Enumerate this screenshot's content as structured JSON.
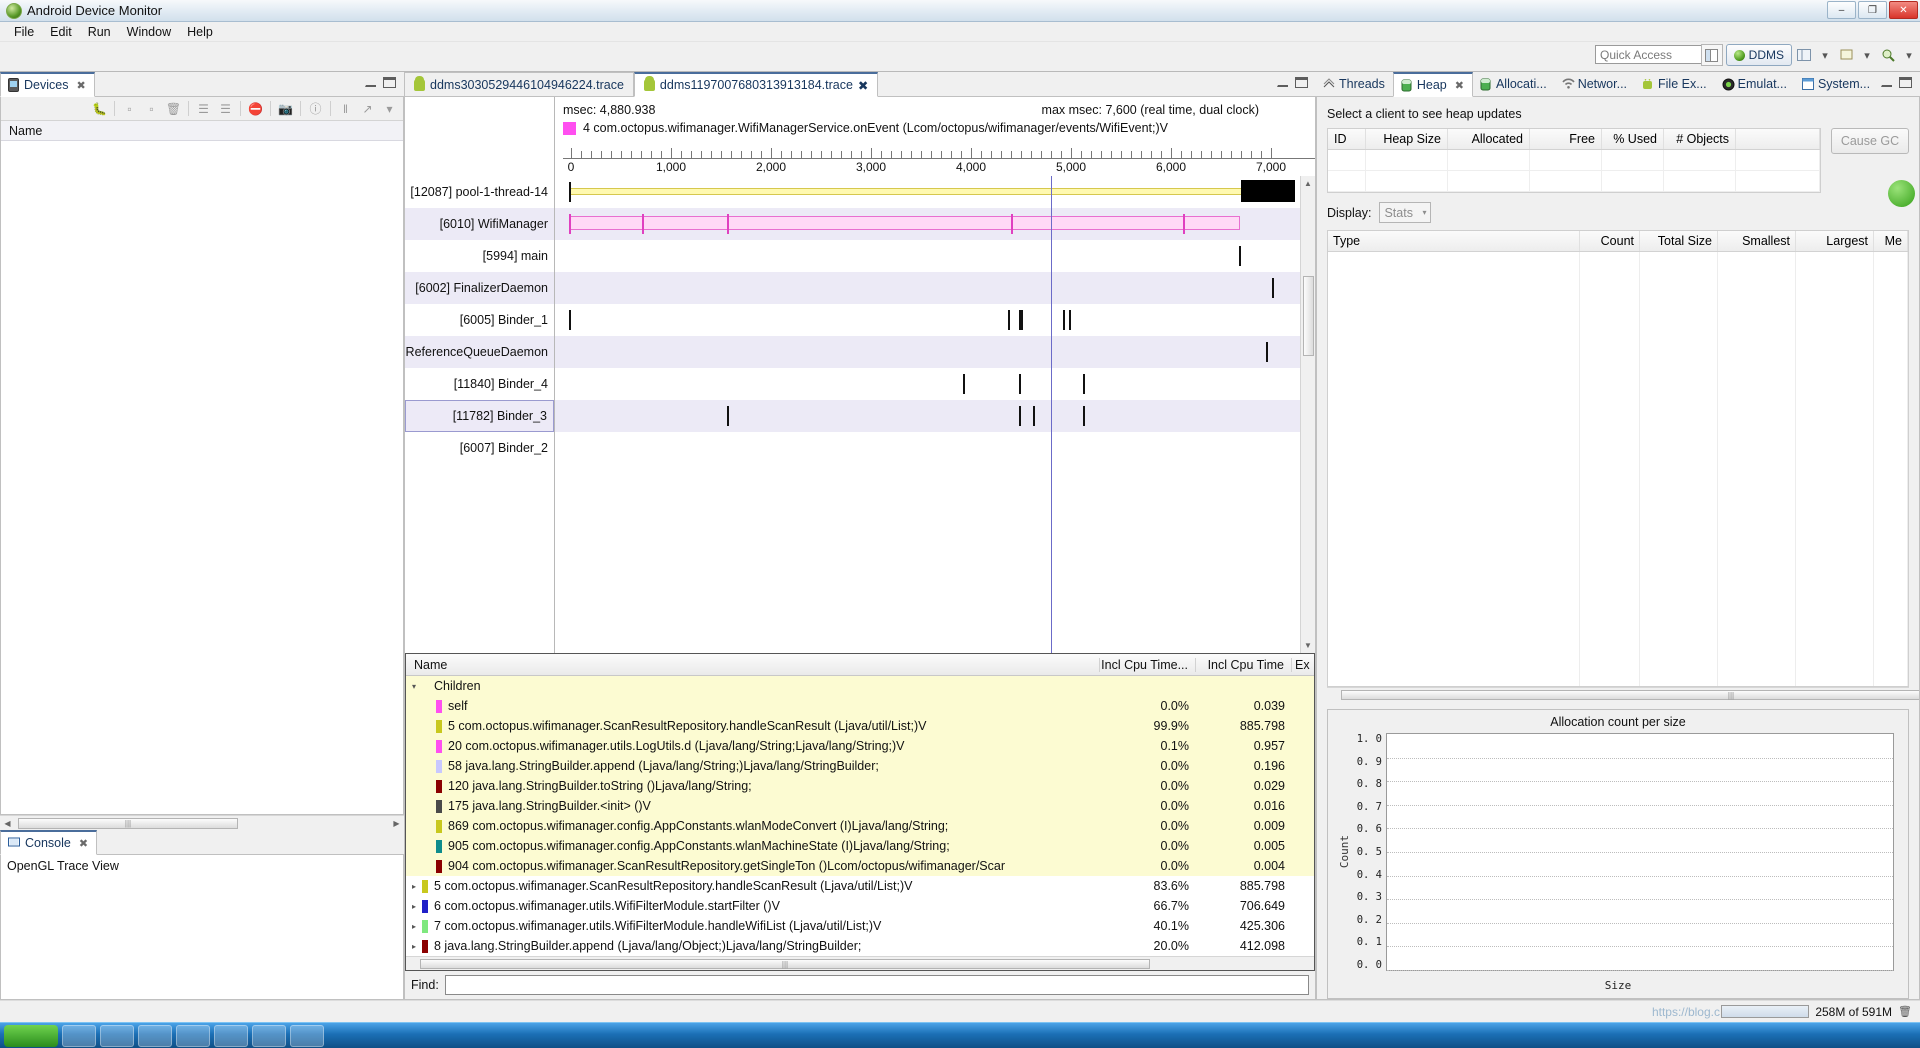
{
  "window": {
    "title": "Android Device Monitor",
    "icon": "android-logo-icon",
    "minimize": "–",
    "maximize": "❐",
    "close": "✕"
  },
  "menu": {
    "items": [
      "File",
      "Edit",
      "Run",
      "Window",
      "Help"
    ]
  },
  "toolbar": {
    "quick_access_placeholder": "Quick Access",
    "open_perspective_icon": "open-perspective-icon",
    "perspective_label": "DDMS",
    "icons": [
      "layout-icon",
      "chevron-down-icon",
      "pin-icon",
      "chevron-down-icon",
      "search-icon",
      "chevron-down-icon"
    ]
  },
  "devices_view": {
    "tab_label": "Devices",
    "tab_icon": "device-icon",
    "close_icon": "close-icon",
    "toolbar_icons": [
      "debug-icon",
      "heap-icon",
      "heap-dump-icon",
      "trash-icon",
      "threads-icon",
      "method-profiling-icon",
      "stop-icon",
      "screenshot-icon",
      "info-icon",
      "systrace-icon",
      "trace-icon",
      "view-menu-icon"
    ],
    "column_header": "Name",
    "rows": []
  },
  "editor": {
    "tabs": [
      {
        "label": "ddms3030529446104946224.trace",
        "icon": "android-icon",
        "active": false
      },
      {
        "label": "ddms1197007680313913184.trace",
        "icon": "android-icon",
        "active": true,
        "close_icon": "close-icon"
      }
    ],
    "minimize_icon": "minimize-icon",
    "maximize_icon": "maximize-icon"
  },
  "timeline": {
    "msec_label": "msec: 4,880.938",
    "max_msec_label": "max msec: 7,600 (real time, dual clock)",
    "selected_method": "4 com.octopus.wifimanager.WifiManagerService.onEvent (Lcom/octopus/wifimanager/events/WifiEvent;)V",
    "selected_method_color": "#ff4ff0",
    "axis_ticks": [
      "0",
      "1,000",
      "2,000",
      "3,000",
      "4,000",
      "5,000",
      "6,000",
      "7,000"
    ],
    "threads": [
      {
        "label": "[12087] pool-1-thread-14"
      },
      {
        "label": "[6010] WifiManager"
      },
      {
        "label": "[5994] main"
      },
      {
        "label": "[6002] FinalizerDaemon"
      },
      {
        "label": "[6005] Binder_1"
      },
      {
        "label": "ReferenceQueueDaemon"
      },
      {
        "label": "[11840] Binder_4"
      },
      {
        "label": "[11782] Binder_3"
      },
      {
        "label": "[6007] Binder_2"
      }
    ]
  },
  "profile_table": {
    "columns": [
      "Name",
      "Incl Cpu Time...",
      "Incl Cpu Time",
      "Ex"
    ],
    "rows": [
      {
        "indent": 0,
        "arrow": "▾",
        "chip": "",
        "name": "Children",
        "c1": "",
        "c2": "",
        "highlight": true
      },
      {
        "indent": 1,
        "arrow": "",
        "chip": "#ff4ff0",
        "name": "self",
        "c1": "0.0%",
        "c2": "0.039",
        "highlight": true
      },
      {
        "indent": 1,
        "arrow": "",
        "chip": "#c8c81e",
        "name": "5 com.octopus.wifimanager.ScanResultRepository.handleScanResult (Ljava/util/List;)V",
        "c1": "99.9%",
        "c2": "885.798",
        "highlight": true
      },
      {
        "indent": 1,
        "arrow": "",
        "chip": "#ff4ff0",
        "name": "20 com.octopus.wifimanager.utils.LogUtils.d (Ljava/lang/String;Ljava/lang/String;)V",
        "c1": "0.1%",
        "c2": "0.957",
        "highlight": true
      },
      {
        "indent": 1,
        "arrow": "",
        "chip": "#c8c8ff",
        "name": "58 java.lang.StringBuilder.append (Ljava/lang/String;)Ljava/lang/StringBuilder;",
        "c1": "0.0%",
        "c2": "0.196",
        "highlight": true
      },
      {
        "indent": 1,
        "arrow": "",
        "chip": "#8b0000",
        "name": "120 java.lang.StringBuilder.toString ()Ljava/lang/String;",
        "c1": "0.0%",
        "c2": "0.029",
        "highlight": true
      },
      {
        "indent": 1,
        "arrow": "",
        "chip": "#4a4a4a",
        "name": "175 java.lang.StringBuilder.<init> ()V",
        "c1": "0.0%",
        "c2": "0.016",
        "highlight": true
      },
      {
        "indent": 1,
        "arrow": "",
        "chip": "#c8c81e",
        "name": "869 com.octopus.wifimanager.config.AppConstants.wlanModeConvert (I)Ljava/lang/String;",
        "c1": "0.0%",
        "c2": "0.009",
        "highlight": true
      },
      {
        "indent": 1,
        "arrow": "",
        "chip": "#0e8c8c",
        "name": "905 com.octopus.wifimanager.config.AppConstants.wlanMachineState (I)Ljava/lang/String;",
        "c1": "0.0%",
        "c2": "0.005",
        "highlight": true
      },
      {
        "indent": 1,
        "arrow": "",
        "chip": "#8b0000",
        "name": "904 com.octopus.wifimanager.ScanResultRepository.getSingleTon ()Lcom/octopus/wifimanager/Scar",
        "c1": "0.0%",
        "c2": "0.004",
        "highlight": true
      },
      {
        "indent": 0,
        "arrow": "▸",
        "chip": "#c8c81e",
        "name": "5 com.octopus.wifimanager.ScanResultRepository.handleScanResult (Ljava/util/List;)V",
        "c1": "83.6%",
        "c2": "885.798",
        "highlight": false
      },
      {
        "indent": 0,
        "arrow": "▸",
        "chip": "#2020c8",
        "name": "6 com.octopus.wifimanager.utils.WifiFilterModule.startFilter ()V",
        "c1": "66.7%",
        "c2": "706.649",
        "highlight": false
      },
      {
        "indent": 0,
        "arrow": "▸",
        "chip": "#7ee87e",
        "name": "7 com.octopus.wifimanager.utils.WifiFilterModule.handleWifiList (Ljava/util/List;)V",
        "c1": "40.1%",
        "c2": "425.306",
        "highlight": false
      },
      {
        "indent": 0,
        "arrow": "▸",
        "chip": "#8b0000",
        "name": "8 java.lang.StringBuilder.append (Ljava/lang/Object;)Ljava/lang/StringBuilder;",
        "c1": "20.0%",
        "c2": "412.098",
        "highlight": false
      }
    ],
    "find_label": "Find:",
    "find_value": ""
  },
  "right_tabs": [
    {
      "label": "Threads",
      "icon": "threads-icon",
      "active": false
    },
    {
      "label": "Heap",
      "icon": "heap-icon",
      "active": true,
      "close_icon": "close-icon"
    },
    {
      "label": "Allocati...",
      "icon": "allocation-tracker-icon",
      "active": false
    },
    {
      "label": "Networ...",
      "icon": "network-icon",
      "active": false
    },
    {
      "label": "File Ex...",
      "icon": "file-explorer-icon",
      "active": false
    },
    {
      "label": "Emulat...",
      "icon": "emulator-control-icon",
      "active": false
    },
    {
      "label": "System...",
      "icon": "system-information-icon",
      "active": false
    }
  ],
  "heap_panel": {
    "message": "Select a client to see heap updates",
    "columns": [
      "ID",
      "Heap Size",
      "Allocated",
      "Free",
      "% Used",
      "# Objects"
    ],
    "rows": [],
    "cause_gc_button": "Cause GC",
    "display_label": "Display:",
    "display_value": "Stats",
    "stats_columns": [
      "Type",
      "Count",
      "Total Size",
      "Smallest",
      "Largest",
      "Me"
    ]
  },
  "chart_data": {
    "type": "bar",
    "title": "Allocation count per size",
    "xlabel": "Size",
    "ylabel": "Count",
    "categories": [],
    "values": [],
    "ylim": [
      0.0,
      1.0
    ],
    "ytick_labels": [
      "1. 0",
      "0. 9",
      "0. 8",
      "0. 7",
      "0. 6",
      "0. 5",
      "0. 4",
      "0. 3",
      "0. 2",
      "0. 1",
      "0. 0"
    ],
    "grid": true,
    "legend": "none"
  },
  "console": {
    "tab_label": "Console",
    "tab_icon": "console-icon",
    "close_icon": "close-icon",
    "content": "OpenGL Trace View",
    "toolbar_icons": [
      "terminate-icon",
      "remove-launch-icon",
      "remove-all-icon",
      "clear-icon",
      "scroll-lock-icon",
      "pin-icon",
      "display-selected-icon",
      "chevron-down-icon",
      "open-console-icon",
      "chevron-down-icon"
    ]
  },
  "statusbar": {
    "memory_text": "258M of 591M",
    "watermark": "https://blog.c"
  }
}
